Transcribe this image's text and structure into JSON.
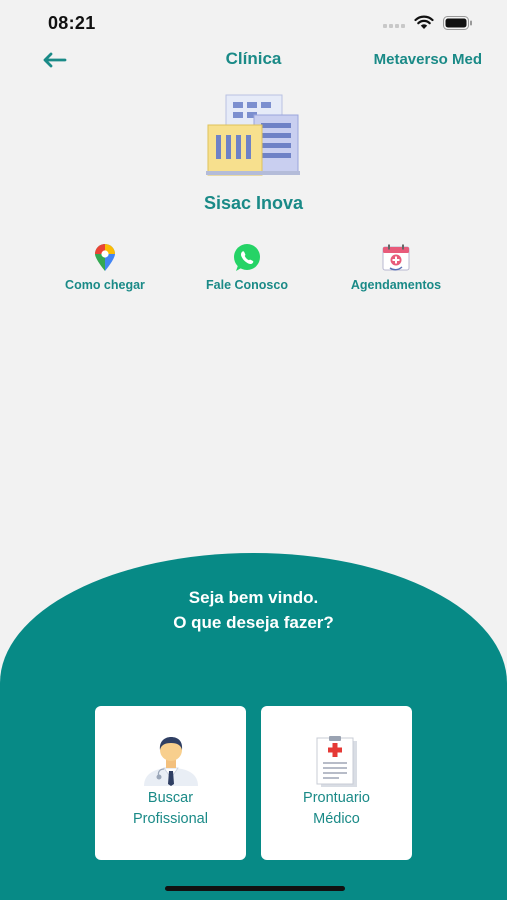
{
  "status": {
    "time": "08:21"
  },
  "nav": {
    "title": "Clínica",
    "right_link": "Metaverso Med"
  },
  "clinic": {
    "name": "Sisac Inova"
  },
  "actions": [
    {
      "label": "Como chegar",
      "icon": "google-maps-pin-icon"
    },
    {
      "label": "Fale Conosco",
      "icon": "whatsapp-icon"
    },
    {
      "label": "Agendamentos",
      "icon": "medical-calendar-icon"
    }
  ],
  "welcome": {
    "line1": "Seja bem vindo.",
    "line2": "O que deseja fazer?"
  },
  "cards": [
    {
      "line1": "Buscar",
      "line2": "Profissional",
      "icon": "doctor-icon"
    },
    {
      "line1": "Prontuario",
      "line2": "Médico",
      "icon": "medical-record-icon"
    }
  ],
  "colors": {
    "accent": "#1a8a87",
    "panel": "#078a86",
    "background": "#f2f2f2"
  }
}
